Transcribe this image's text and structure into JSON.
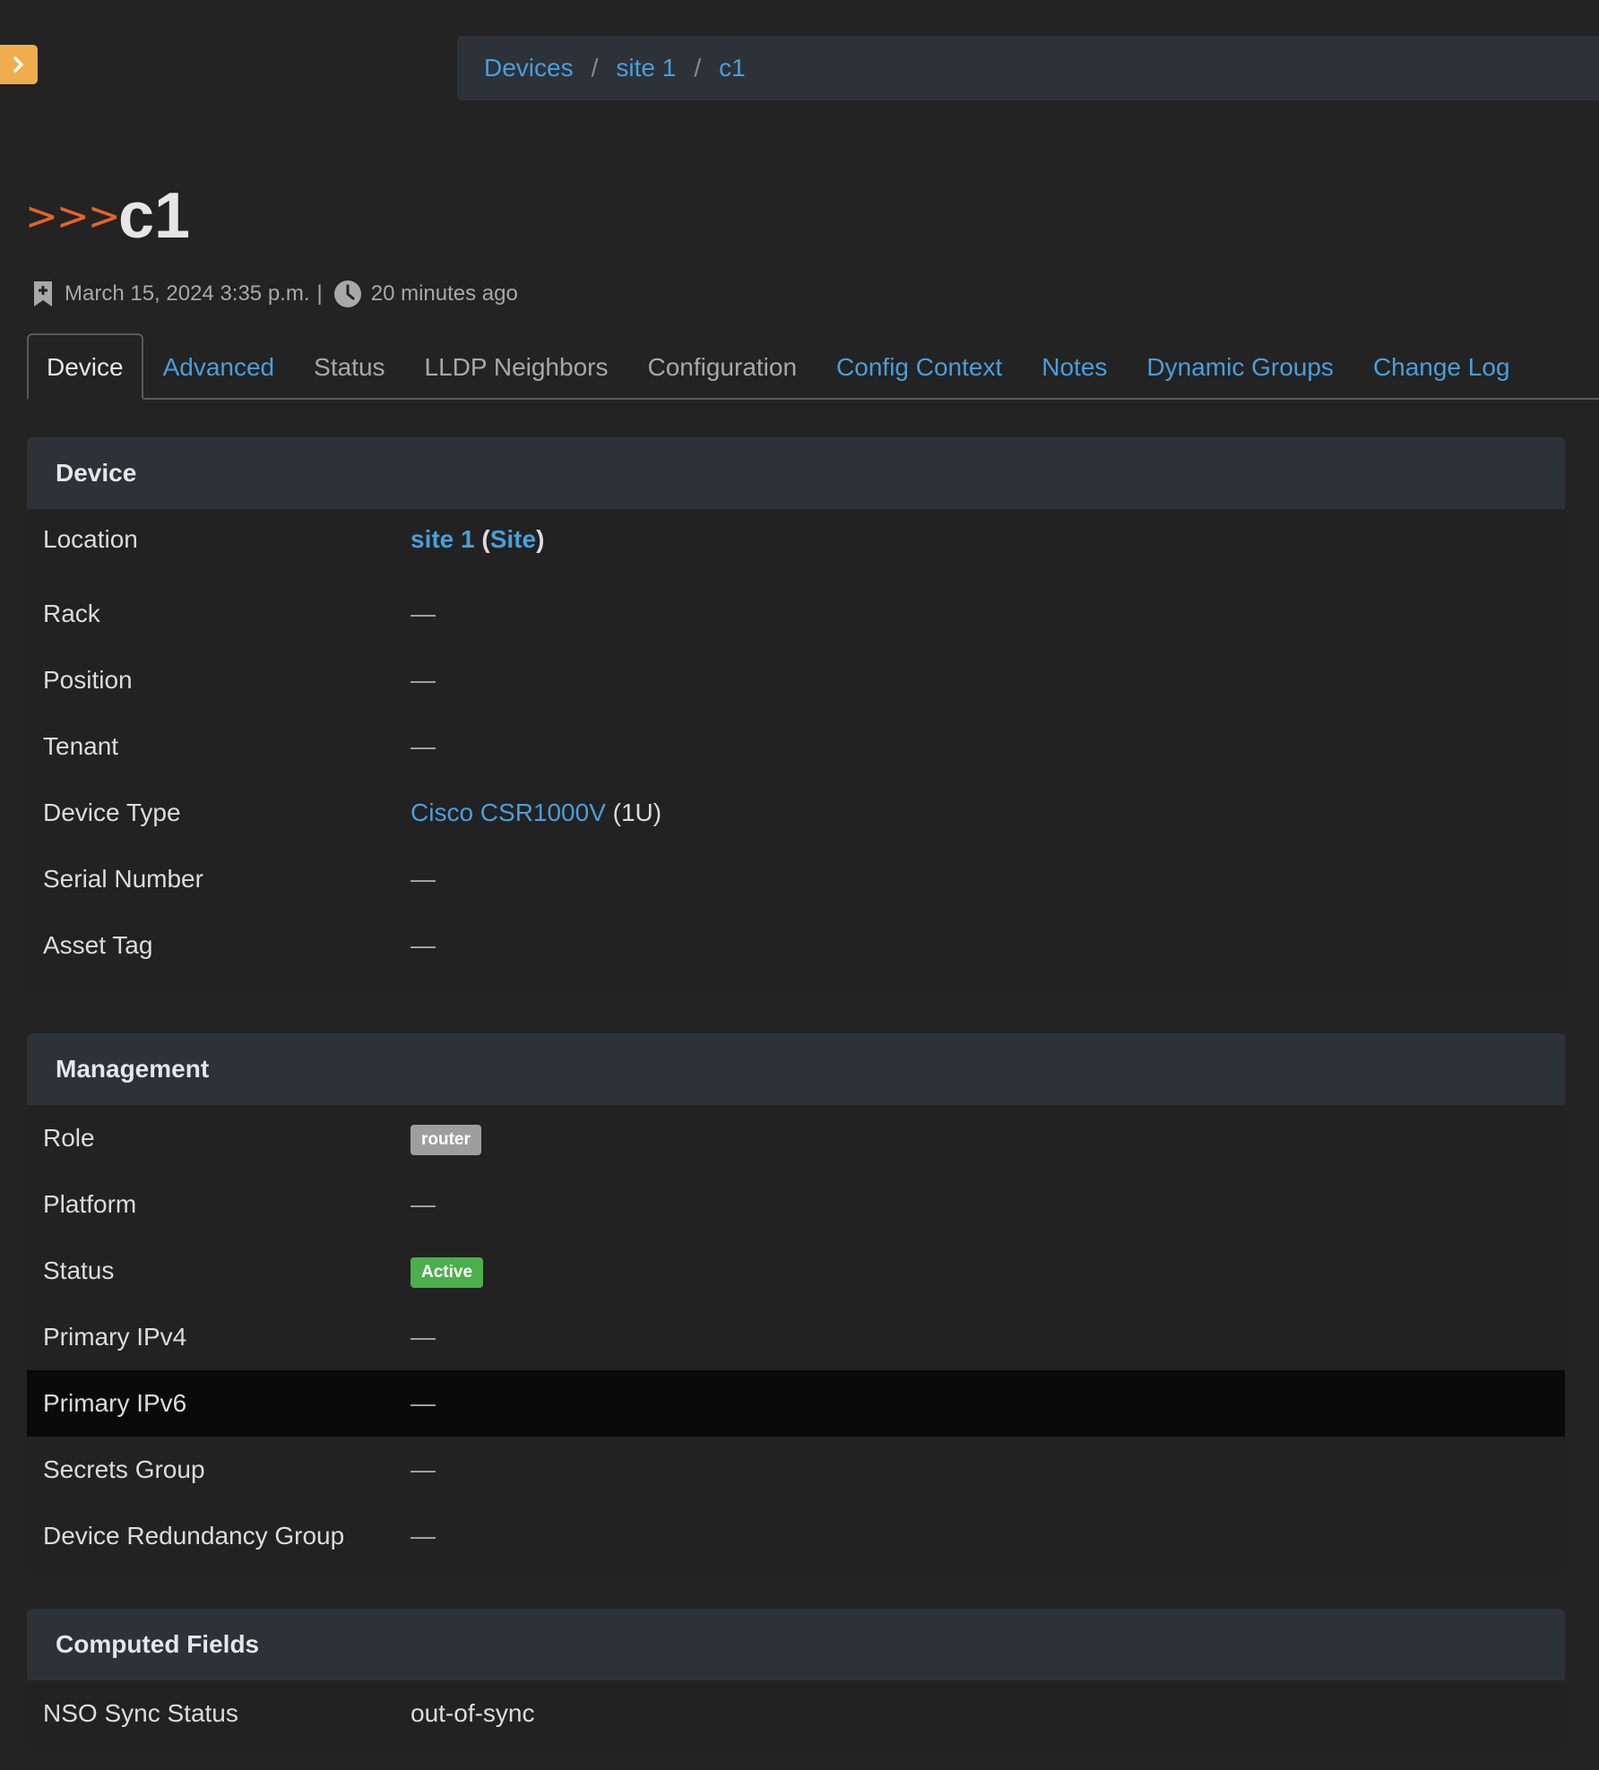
{
  "colors": {
    "background": "#232323",
    "accent_link": "#4a9eda",
    "sidebar_toggle": "#f0ad4e",
    "chevrons": "#e4632a",
    "badge_role": "#9e9e9e",
    "badge_status": "#4cae4c",
    "panel_heading": "#2c3238"
  },
  "sidebar_toggle_icon": "chevron-right-icon",
  "breadcrumb": {
    "items": [
      "Devices",
      "site 1",
      "c1"
    ],
    "separator": "/"
  },
  "header": {
    "chevrons": ">>>",
    "title": "c1"
  },
  "meta": {
    "created": "March 15, 2024 3:35 p.m.",
    "divider": "|",
    "updated": "20 minutes ago"
  },
  "tabs": [
    {
      "label": "Device"
    },
    {
      "label": "Advanced"
    },
    {
      "label": "Status"
    },
    {
      "label": "LLDP Neighbors"
    },
    {
      "label": "Configuration"
    },
    {
      "label": "Config Context"
    },
    {
      "label": "Notes"
    },
    {
      "label": "Dynamic Groups"
    },
    {
      "label": "Change Log"
    }
  ],
  "device_panel": {
    "heading": "Device",
    "location_label": "Location",
    "location_value": "site 1",
    "location_paren_open": "(",
    "location_type": "Site",
    "location_paren_close": ")",
    "rack_label": "Rack",
    "rack_value": "—",
    "position_label": "Position",
    "position_value": "—",
    "tenant_label": "Tenant",
    "tenant_value": "—",
    "device_type_label": "Device Type",
    "device_type_value": "Cisco CSR1000V",
    "device_type_suffix": "(1U)",
    "serial_label": "Serial Number",
    "serial_value": "—",
    "asset_label": "Asset Tag",
    "asset_value": "—"
  },
  "management_panel": {
    "heading": "Management",
    "role_label": "Role",
    "role_value": "router",
    "platform_label": "Platform",
    "platform_value": "—",
    "status_label": "Status",
    "status_value": "Active",
    "ipv4_label": "Primary IPv4",
    "ipv4_value": "—",
    "ipv6_label": "Primary IPv6",
    "ipv6_value": "—",
    "secrets_label": "Secrets Group",
    "secrets_value": "—",
    "redundancy_label": "Device Redundancy Group",
    "redundancy_value": "—"
  },
  "computed_panel": {
    "heading": "Computed Fields",
    "nso_label": "NSO Sync Status",
    "nso_value": "out-of-sync"
  }
}
